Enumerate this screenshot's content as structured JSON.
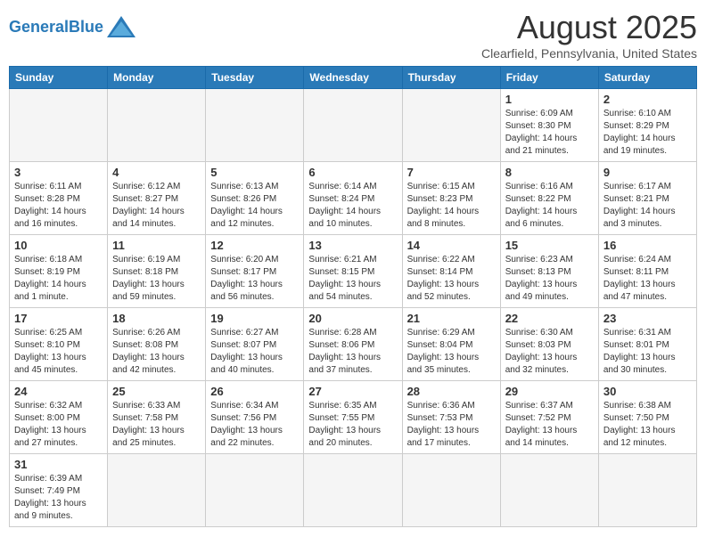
{
  "header": {
    "logo_text_general": "General",
    "logo_text_blue": "Blue",
    "month_year": "August 2025",
    "location": "Clearfield, Pennsylvania, United States"
  },
  "columns": [
    "Sunday",
    "Monday",
    "Tuesday",
    "Wednesday",
    "Thursday",
    "Friday",
    "Saturday"
  ],
  "weeks": [
    {
      "days": [
        {
          "number": "",
          "info": ""
        },
        {
          "number": "",
          "info": ""
        },
        {
          "number": "",
          "info": ""
        },
        {
          "number": "",
          "info": ""
        },
        {
          "number": "",
          "info": ""
        },
        {
          "number": "1",
          "info": "Sunrise: 6:09 AM\nSunset: 8:30 PM\nDaylight: 14 hours and 21 minutes."
        },
        {
          "number": "2",
          "info": "Sunrise: 6:10 AM\nSunset: 8:29 PM\nDaylight: 14 hours and 19 minutes."
        }
      ]
    },
    {
      "days": [
        {
          "number": "3",
          "info": "Sunrise: 6:11 AM\nSunset: 8:28 PM\nDaylight: 14 hours and 16 minutes."
        },
        {
          "number": "4",
          "info": "Sunrise: 6:12 AM\nSunset: 8:27 PM\nDaylight: 14 hours and 14 minutes."
        },
        {
          "number": "5",
          "info": "Sunrise: 6:13 AM\nSunset: 8:26 PM\nDaylight: 14 hours and 12 minutes."
        },
        {
          "number": "6",
          "info": "Sunrise: 6:14 AM\nSunset: 8:24 PM\nDaylight: 14 hours and 10 minutes."
        },
        {
          "number": "7",
          "info": "Sunrise: 6:15 AM\nSunset: 8:23 PM\nDaylight: 14 hours and 8 minutes."
        },
        {
          "number": "8",
          "info": "Sunrise: 6:16 AM\nSunset: 8:22 PM\nDaylight: 14 hours and 6 minutes."
        },
        {
          "number": "9",
          "info": "Sunrise: 6:17 AM\nSunset: 8:21 PM\nDaylight: 14 hours and 3 minutes."
        }
      ]
    },
    {
      "days": [
        {
          "number": "10",
          "info": "Sunrise: 6:18 AM\nSunset: 8:19 PM\nDaylight: 14 hours and 1 minute."
        },
        {
          "number": "11",
          "info": "Sunrise: 6:19 AM\nSunset: 8:18 PM\nDaylight: 13 hours and 59 minutes."
        },
        {
          "number": "12",
          "info": "Sunrise: 6:20 AM\nSunset: 8:17 PM\nDaylight: 13 hours and 56 minutes."
        },
        {
          "number": "13",
          "info": "Sunrise: 6:21 AM\nSunset: 8:15 PM\nDaylight: 13 hours and 54 minutes."
        },
        {
          "number": "14",
          "info": "Sunrise: 6:22 AM\nSunset: 8:14 PM\nDaylight: 13 hours and 52 minutes."
        },
        {
          "number": "15",
          "info": "Sunrise: 6:23 AM\nSunset: 8:13 PM\nDaylight: 13 hours and 49 minutes."
        },
        {
          "number": "16",
          "info": "Sunrise: 6:24 AM\nSunset: 8:11 PM\nDaylight: 13 hours and 47 minutes."
        }
      ]
    },
    {
      "days": [
        {
          "number": "17",
          "info": "Sunrise: 6:25 AM\nSunset: 8:10 PM\nDaylight: 13 hours and 45 minutes."
        },
        {
          "number": "18",
          "info": "Sunrise: 6:26 AM\nSunset: 8:08 PM\nDaylight: 13 hours and 42 minutes."
        },
        {
          "number": "19",
          "info": "Sunrise: 6:27 AM\nSunset: 8:07 PM\nDaylight: 13 hours and 40 minutes."
        },
        {
          "number": "20",
          "info": "Sunrise: 6:28 AM\nSunset: 8:06 PM\nDaylight: 13 hours and 37 minutes."
        },
        {
          "number": "21",
          "info": "Sunrise: 6:29 AM\nSunset: 8:04 PM\nDaylight: 13 hours and 35 minutes."
        },
        {
          "number": "22",
          "info": "Sunrise: 6:30 AM\nSunset: 8:03 PM\nDaylight: 13 hours and 32 minutes."
        },
        {
          "number": "23",
          "info": "Sunrise: 6:31 AM\nSunset: 8:01 PM\nDaylight: 13 hours and 30 minutes."
        }
      ]
    },
    {
      "days": [
        {
          "number": "24",
          "info": "Sunrise: 6:32 AM\nSunset: 8:00 PM\nDaylight: 13 hours and 27 minutes."
        },
        {
          "number": "25",
          "info": "Sunrise: 6:33 AM\nSunset: 7:58 PM\nDaylight: 13 hours and 25 minutes."
        },
        {
          "number": "26",
          "info": "Sunrise: 6:34 AM\nSunset: 7:56 PM\nDaylight: 13 hours and 22 minutes."
        },
        {
          "number": "27",
          "info": "Sunrise: 6:35 AM\nSunset: 7:55 PM\nDaylight: 13 hours and 20 minutes."
        },
        {
          "number": "28",
          "info": "Sunrise: 6:36 AM\nSunset: 7:53 PM\nDaylight: 13 hours and 17 minutes."
        },
        {
          "number": "29",
          "info": "Sunrise: 6:37 AM\nSunset: 7:52 PM\nDaylight: 13 hours and 14 minutes."
        },
        {
          "number": "30",
          "info": "Sunrise: 6:38 AM\nSunset: 7:50 PM\nDaylight: 13 hours and 12 minutes."
        }
      ]
    },
    {
      "days": [
        {
          "number": "31",
          "info": "Sunrise: 6:39 AM\nSunset: 7:49 PM\nDaylight: 13 hours and 9 minutes."
        },
        {
          "number": "",
          "info": ""
        },
        {
          "number": "",
          "info": ""
        },
        {
          "number": "",
          "info": ""
        },
        {
          "number": "",
          "info": ""
        },
        {
          "number": "",
          "info": ""
        },
        {
          "number": "",
          "info": ""
        }
      ]
    }
  ]
}
